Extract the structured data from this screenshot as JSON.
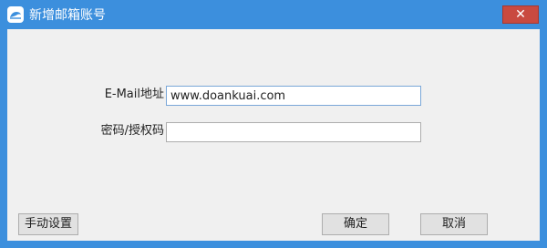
{
  "window": {
    "title": "新增邮箱账号",
    "close_glyph": "✕"
  },
  "form": {
    "email": {
      "label": "E-Mail地址",
      "value": "www.doankuai.com"
    },
    "password": {
      "label": "密码/授权码",
      "value": ""
    }
  },
  "buttons": {
    "manual_settings": "手动设置",
    "confirm": "确定",
    "cancel": "取消"
  },
  "colors": {
    "titlebar": "#3c8fdd",
    "close_button": "#c94a40",
    "client_background": "#f0f0f0"
  }
}
